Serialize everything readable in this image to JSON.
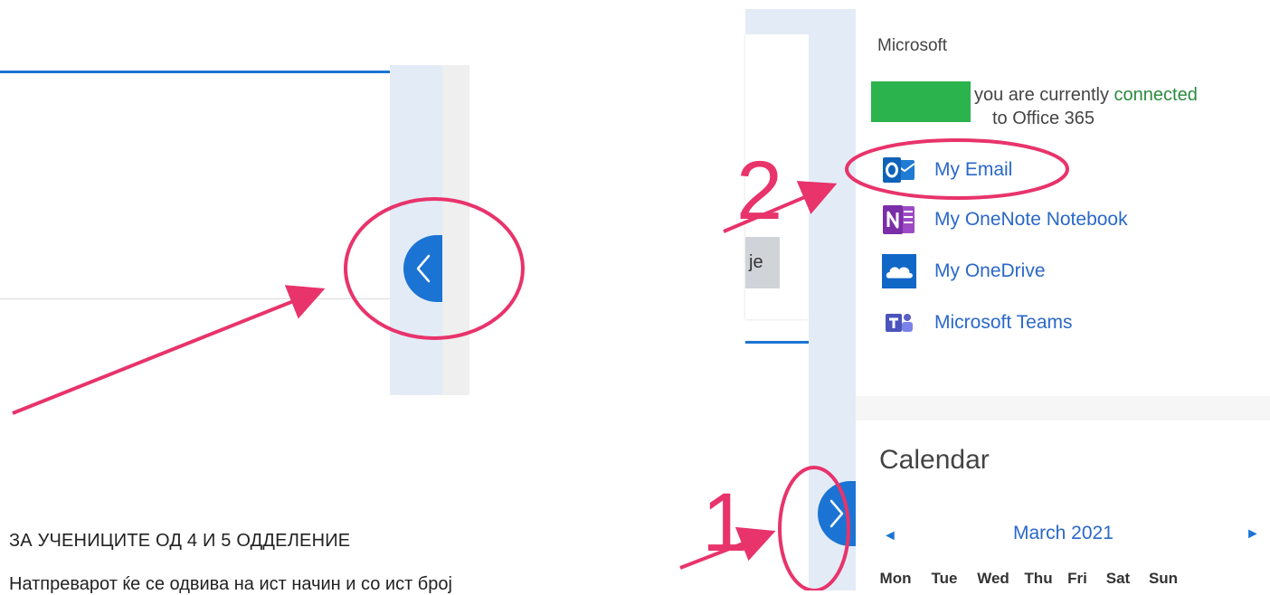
{
  "annotations": {
    "step1_label": "1",
    "step2_label": "2",
    "color": "#e8336b"
  },
  "document": {
    "heading": "ЗА УЧЕНИЦИТЕ ОД 4 И 5 ОДДЕЛЕНИЕ",
    "body": "Натпреварот ќе се одвива на ист начин и со ист број"
  },
  "left_panel": {
    "toggle_icon": "chevron-left-icon"
  },
  "background_page": {
    "button_fragment": "je"
  },
  "microsoft_panel": {
    "title": "Microsoft",
    "connection_prefix": "you are currently ",
    "connection_status": "connected",
    "connection_suffix": "to Office 365",
    "links": [
      {
        "label": "My Email",
        "icon": "outlook-icon"
      },
      {
        "label": "My OneNote Notebook",
        "icon": "onenote-icon"
      },
      {
        "label": "My OneDrive",
        "icon": "onedrive-icon"
      },
      {
        "label": "Microsoft Teams",
        "icon": "teams-icon"
      }
    ]
  },
  "calendar": {
    "title": "Calendar",
    "month": "March 2021",
    "prev": "◄",
    "next": "►",
    "weekdays": [
      "Mon",
      "Tue",
      "Wed",
      "Thu",
      "Fri",
      "Sat",
      "Sun"
    ]
  },
  "colors": {
    "accent_blue": "#1b74d4",
    "link_blue": "#2a68c8",
    "sidebar_strip": "#e3ecf6",
    "redacted_green": "#2bb44d"
  }
}
